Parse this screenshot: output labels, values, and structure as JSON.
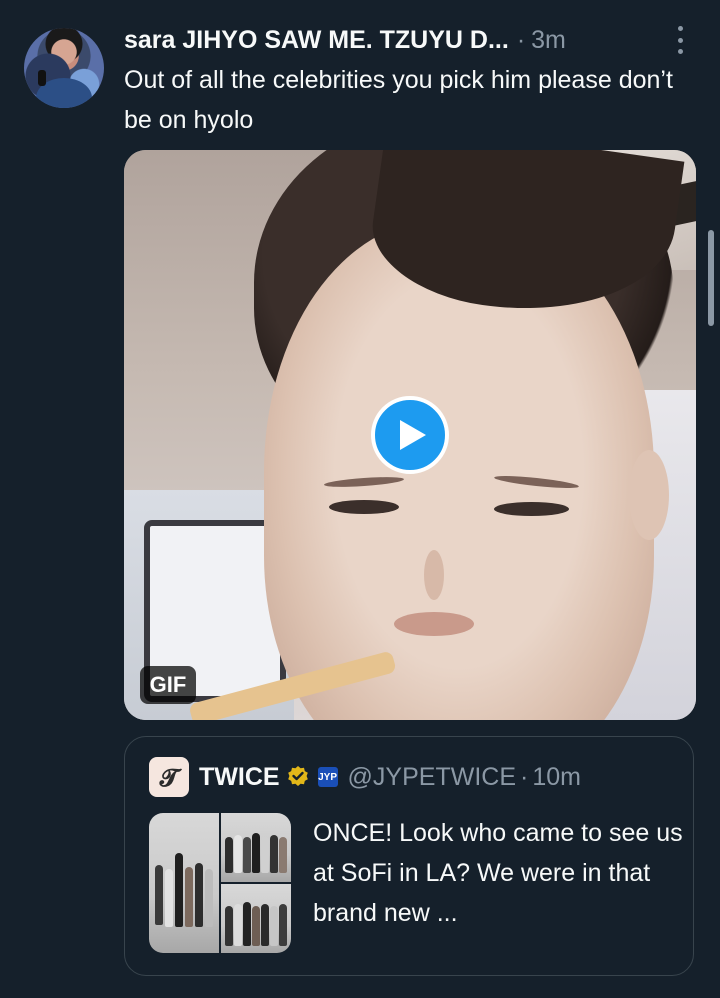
{
  "tweet": {
    "display_name": "sara JIHYO SAW ME. TZUYU D...",
    "separator": "·",
    "time": "3m",
    "text": "Out of all the celebrities you pick him please don’t be on hyolo",
    "media": {
      "badge": "GIF",
      "play_icon": "play-icon"
    }
  },
  "quoted": {
    "avatar_glyph": "𝓣",
    "name": "TWICE",
    "verified_icon": "verified-gold-badge-icon",
    "affiliate_label": "JYP",
    "handle": "@JYPETWICE",
    "separator": "·",
    "time": "10m",
    "text": "ONCE! Look who came to see us at SoFi in LA? We were in that brand new ..."
  },
  "colors": {
    "background": "#15202b",
    "primary_text": "#f7f9f9",
    "secondary_text": "#8b98a5",
    "accent": "#1d9bf0",
    "verified_gold": "#e2b719",
    "border": "#38444d"
  }
}
